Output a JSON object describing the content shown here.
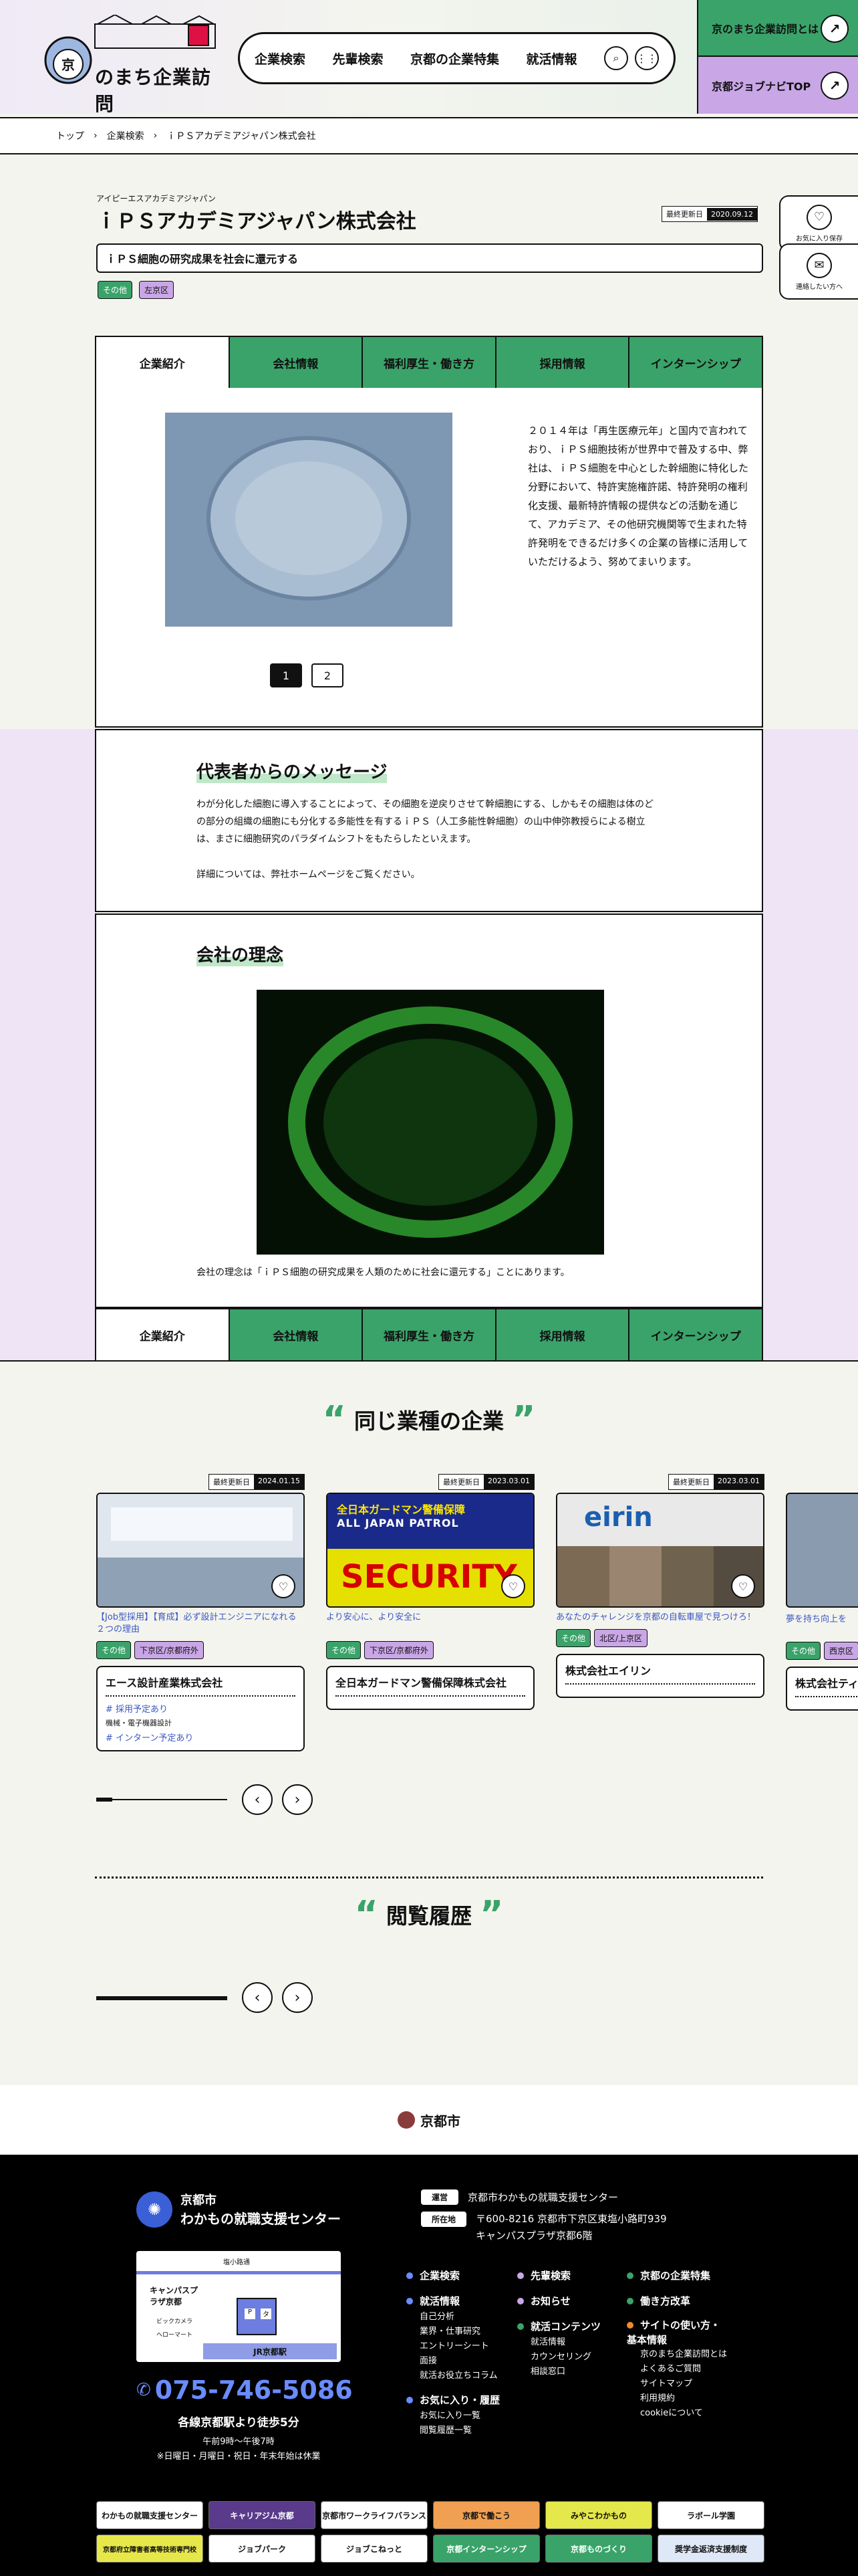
{
  "header": {
    "logo_text": "のまち企業訪問",
    "nav": [
      "企業検索",
      "先輩検索",
      "京都の企業特集",
      "就活情報"
    ],
    "side_btn1": "京のまち企業訪問とは",
    "side_btn2": "京都ジョブナビTOP"
  },
  "breadcrumb": [
    "トップ",
    "企業検索",
    "ｉＰＳアカデミアジャパン株式会社"
  ],
  "company": {
    "kana": "アイピーエスアカデミアジャパン",
    "name": "ｉＰＳアカデミアジャパン株式会社",
    "updated_label": "最終更新日",
    "updated_date": "2020.09.12",
    "catch": "ｉＰＳ細胞の研究成果を社会に還元する",
    "tags": [
      "その他",
      "左京区"
    ]
  },
  "side": {
    "save": "お気に入り保存",
    "contact": "連絡したい方へ"
  },
  "tabs": [
    "企業紹介",
    "会社情報",
    "福利厚生・働き方",
    "採用情報",
    "インターンシップ"
  ],
  "intro": {
    "text": "２０１４年は「再生医療元年」と国内で言われており、ｉＰＳ細胞技術が世界中で普及する中、弊社は、ｉＰＳ細胞を中心とした幹細胞に特化した分野において、特許実施権許諾、特許発明の権利化支援、最新特許情報の提供などの活動を通じて、アカデミア、その他研究機関等で生まれた特許発明をできるだけ多くの企業の皆様に活用していただけるよう、努めてまいります。",
    "pages": [
      "1",
      "2"
    ]
  },
  "message": {
    "title": "代表者からのメッセージ",
    "text": "わが分化した細胞に導入することによって、その細胞を逆戻りさせて幹細胞にする、しかもその細胞は体のどの部分の組織の細胞にも分化する多能性を有するｉＰＳ（人工多能性幹細胞）の山中伸弥教授らによる樹立は、まさに細胞研究のパラダイムシフトをもたらしたといえます。",
    "text2": "詳細については、弊社ホームページをご覧ください。"
  },
  "philosophy": {
    "title": "会社の理念",
    "text": "会社の理念は「ｉＰＳ細胞の研究成果を人類のために社会に還元する」ことにあります。"
  },
  "same": {
    "title": "同じ業種の企業",
    "cards": [
      {
        "date": "2024.01.15",
        "caption": "【Job型採用】【育成】必ず設計エンジニアになれる２つの理由",
        "tags": [
          "その他",
          "下京区/京都府外"
        ],
        "name": "エース設計産業株式会社",
        "links": [
          "# 採用予定あり",
          "# インターン予定あり"
        ],
        "sub": "機械・電子機器設計"
      },
      {
        "date": "2023.03.01",
        "caption": "より安心に、より安全に",
        "tags": [
          "その他",
          "下京区/京都府外"
        ],
        "name": "全日本ガードマン警備保障株式会社",
        "img_text": "SECURITY",
        "img_top": "全日本ガードマン警備保障",
        "img_top2": "ALL JAPAN PATROL"
      },
      {
        "date": "2023.03.01",
        "caption": "あなたのチャレンジを京都の自転車屋で見つけろ！",
        "tags": [
          "その他",
          "北区/上京区"
        ],
        "name": "株式会社エイリン",
        "img_text": "eirin"
      },
      {
        "date": "",
        "caption": "夢を持ち向上を",
        "tags": [
          "その他",
          "西京区"
        ],
        "name": "株式会社ティ"
      }
    ],
    "update_label": "最終更新日"
  },
  "history": {
    "title": "閲覧履歴"
  },
  "city": "京都市",
  "footer": {
    "org1": "京都市",
    "org2": "わかもの就職支援センター",
    "op_label": "運営",
    "op_text": "京都市わかもの就職支援センター",
    "loc_label": "所在地",
    "loc_text1": "〒600-8216 京都市下京区東塩小路町939",
    "loc_text2": "キャンパスプラザ京都6階",
    "tel": "075-746-5086",
    "access": "各線京都駅より徒歩5分",
    "hours": "午前9時〜午後7時",
    "closed": "※日曜日・月曜日・祝日・年末年始は休業",
    "map_labels": [
      "塩小路通",
      "キャンパスプラザ京都",
      "ビックカメラ",
      "ヘローマート",
      "JR京都駅",
      "P",
      "タ"
    ],
    "col1": [
      "企業検索",
      "就活情報",
      "自己分析",
      "業界・仕事研究",
      "エントリーシート",
      "面接",
      "就活お役立ちコラム",
      "お気に入り・履歴",
      "お気に入り一覧",
      "閲覧履歴一覧"
    ],
    "col2": [
      "先輩検索",
      "お知らせ",
      "就活コンテンツ",
      "就活情報",
      "カウンセリング",
      "相談窓口"
    ],
    "col3": [
      "京都の企業特集",
      "働き方改革",
      "サイトの使い方・基本情報",
      "京のまち企業訪問とは",
      "よくあるご質問",
      "サイトマップ",
      "利用規約",
      "cookieについて"
    ],
    "banners": [
      "わかもの就職支援センター",
      "キャリアジム京都",
      "京都市ワークライフバランス",
      "京都で働こう",
      "みやこわかもの",
      "ラボール学園",
      "京都府立障害者高等技術専門校",
      "ジョブパーク",
      "ジョブこねっと",
      "京都インターンシップ",
      "京都ものづくり",
      "奨学金返済支援制度"
    ]
  },
  "colors": {
    "green": "#3aa36a",
    "purple": "#c9a6e6",
    "lavender": "#efe4f6",
    "footer": "#000000",
    "phone": "#6a8cff"
  }
}
